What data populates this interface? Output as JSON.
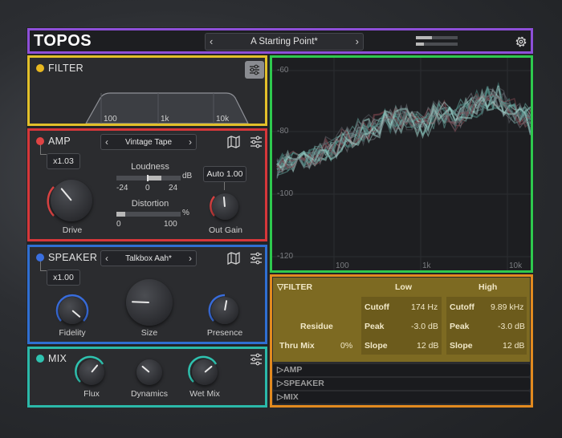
{
  "header": {
    "logo": "TOPOS",
    "preset_prev": "‹",
    "preset_name": "A Starting Point*",
    "preset_next": "›"
  },
  "filter": {
    "title": "FILTER",
    "dot_color": "#e8b820",
    "freq_labels": [
      "100",
      "1k",
      "10k"
    ]
  },
  "amp": {
    "title": "AMP",
    "dot_color": "#e04444",
    "drive_value": "x1.03",
    "model": "Vintage Tape",
    "drive_label": "Drive",
    "loudness_label": "Loudness",
    "loudness_unit": "dB",
    "loudness_min": "-24",
    "loudness_mid": "0",
    "loudness_max": "24",
    "distortion_label": "Distortion",
    "distortion_unit": "%",
    "distortion_min": "0",
    "distortion_max": "100",
    "auto_label": "Auto",
    "auto_value": "1.00",
    "out_gain_label": "Out Gain"
  },
  "speaker": {
    "title": "SPEAKER",
    "dot_color": "#3a6fe0",
    "value": "x1.00",
    "model": "Talkbox Aah*",
    "fidelity_label": "Fidelity",
    "size_label": "Size",
    "presence_label": "Presence"
  },
  "mix": {
    "title": "MIX",
    "dot_color": "#2fc3b0",
    "flux_label": "Flux",
    "dynamics_label": "Dynamics",
    "wetmix_label": "Wet Mix"
  },
  "spectrum": {
    "db_labels": [
      "-60",
      "-80",
      "-100",
      "-120"
    ],
    "freq_labels": [
      "100",
      "1k",
      "10k"
    ]
  },
  "detail": {
    "filter_title": "▽FILTER",
    "low_header": "Low",
    "high_header": "High",
    "residue_label": "Residue",
    "thru_mix_label": "Thru Mix",
    "thru_mix_value": "0%",
    "low": {
      "cutoff_label": "Cutoff",
      "cutoff_value": "174 Hz",
      "peak_label": "Peak",
      "peak_value": "-3.0 dB",
      "slope_label": "Slope",
      "slope_value": "12 dB"
    },
    "high": {
      "cutoff_label": "Cutoff",
      "cutoff_value": "9.89 kHz",
      "peak_label": "Peak",
      "peak_value": "-3.0 dB",
      "slope_label": "Slope",
      "slope_value": "12 dB"
    },
    "amp_fold": "▷AMP",
    "speaker_fold": "▷SPEAKER",
    "mix_fold": "▷MIX"
  }
}
